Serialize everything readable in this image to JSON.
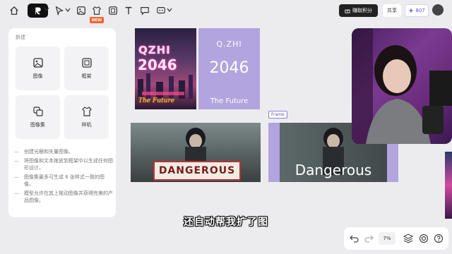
{
  "toolbar": {
    "new_badge": "NEW",
    "earn_label": "赚取积分",
    "share_label": "共享",
    "credits_value": "807"
  },
  "panel": {
    "title": "新建",
    "tiles": [
      {
        "label": "图像",
        "icon": "image-icon"
      },
      {
        "label": "框架",
        "icon": "frame-icon"
      },
      {
        "label": "图像集",
        "icon": "image-set-icon"
      },
      {
        "label": "样机",
        "icon": "mockup-tshirt-icon"
      }
    ],
    "bullets": [
      "创建光栅和矢量图像。",
      "将图像和文本拖放到框架中以生成任何图形设计。",
      "图像集最多可生成 6 张样式一致的图像。",
      "模型允许在其上拖动图像并获得完美的产品图像。"
    ]
  },
  "canvas": {
    "poster": {
      "line1": "QZHI",
      "line2": "2046",
      "line3": "The Future"
    },
    "purple_card": {
      "line1": "Q.ZHI",
      "line2": "2046",
      "line3": "The Future"
    },
    "frame_tag": "Frame",
    "sign_text": "DANGEROUS",
    "frame_text": "Dangerous"
  },
  "subtitle": "还自动帮我扩了图",
  "bottombar": {
    "zoom": "7%"
  }
}
